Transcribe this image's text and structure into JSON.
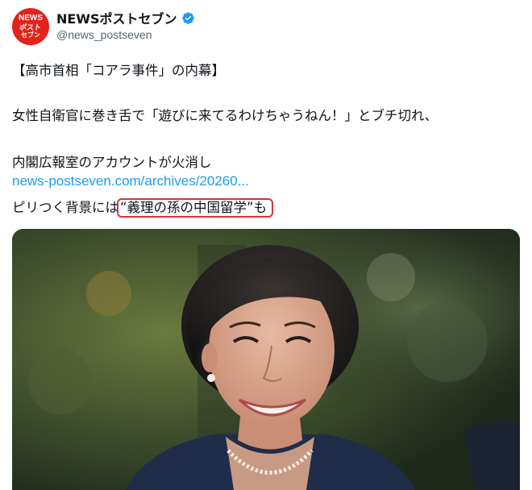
{
  "account": {
    "avatar_text": [
      "NEWS",
      "ポスト",
      "セブン"
    ],
    "display_name": "NEWSポストセブン",
    "handle": "@news_postseven",
    "verified_icon": "verified-badge-icon"
  },
  "tweet": {
    "line1": "【高市首相「コアラ事件」の内幕】",
    "line2": "女性自衛官に巻き舌で「遊びに来てるわけちゃうねん！」とブチ切れ、",
    "line3": "内閣広報室のアカウントが火消し",
    "link": "news-postseven.com/archives/20260...",
    "line5_prefix": "ピリつく背景には",
    "line5_highlight": "“義理の孫の中国留学”",
    "line5_suffix": "も"
  },
  "colors": {
    "brand_red": "#e2231a",
    "link_blue": "#1d9bf0",
    "verified_blue": "#1d9bf0",
    "highlight_outline": "#d8323a"
  },
  "media": {
    "type": "photo",
    "icon": "photo-icon"
  }
}
